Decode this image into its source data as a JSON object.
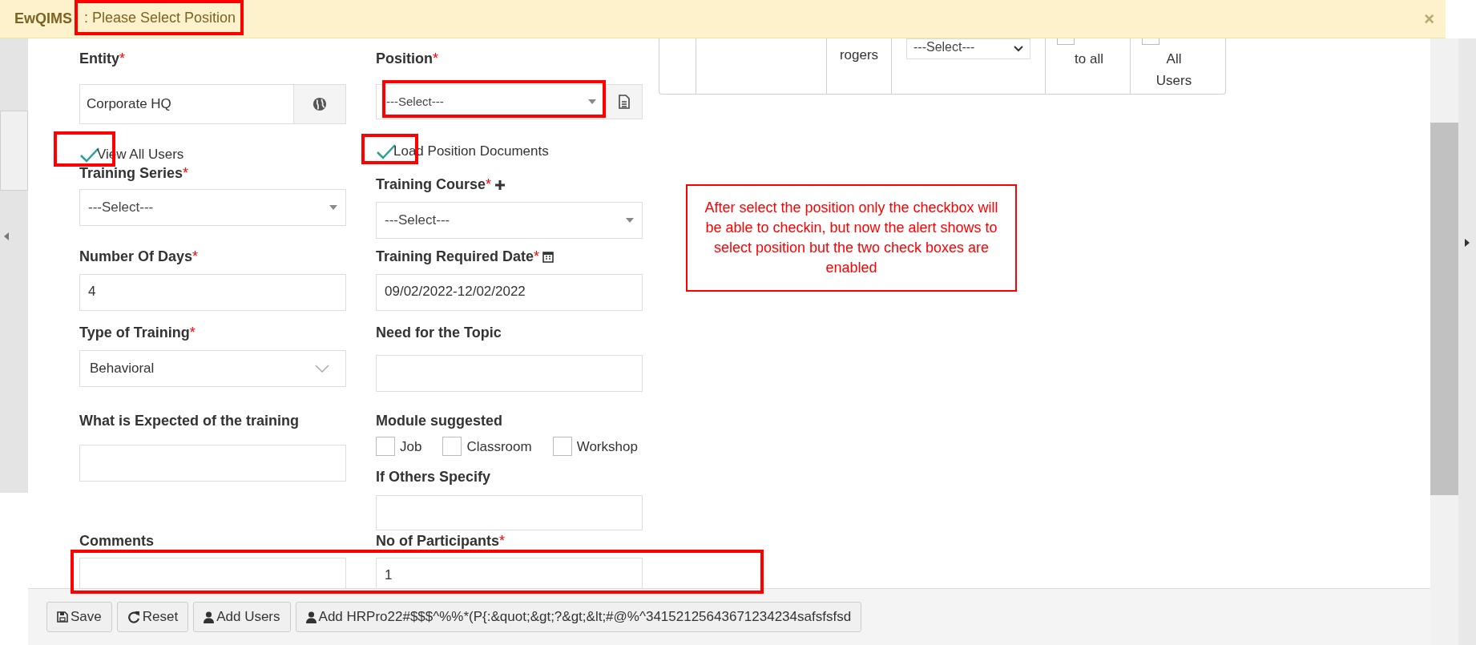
{
  "alert": {
    "app": "EwQIMS",
    "message": ": Please Select Position",
    "close": "×"
  },
  "table_fragment": {
    "cells": [
      {
        "kind": "empty"
      },
      {
        "kind": "empty"
      },
      {
        "kind": "text",
        "text": "rogers"
      },
      {
        "kind": "select",
        "value": "---Select---"
      },
      {
        "kind": "check",
        "text": "to all",
        "checked": false
      },
      {
        "kind": "check",
        "text": "All Users",
        "checked": false
      }
    ]
  },
  "form": {
    "rows": [
      [
        {
          "kind": "lookup",
          "label": "Entity",
          "required_mark": "*",
          "value": "Corporate HQ"
        },
        {
          "kind": "select_doc",
          "label": "Position",
          "required_mark": "*",
          "value": "---Select---"
        }
      ],
      [
        {
          "kind": "checkbox",
          "label": "View All Users",
          "checked": true
        },
        {
          "kind": "checkbox",
          "label": "Load Position Documents",
          "checked": true
        }
      ],
      [
        {
          "kind": "select",
          "label": "Training Series",
          "required_mark": "*",
          "value": "---Select---"
        },
        {
          "kind": "select",
          "label": "Training Course",
          "required_mark": "*",
          "add_button": true,
          "value": "---Select---"
        }
      ],
      [
        {
          "kind": "input",
          "label": "Number Of Days",
          "required_mark": "*",
          "value": "4"
        },
        {
          "kind": "input",
          "label": "Training Required Date",
          "required_mark": "*",
          "date_picker": true,
          "value": "09/02/2022-12/02/2022"
        }
      ],
      [
        {
          "kind": "dropdown",
          "label": "Type of Training",
          "required_mark": "*",
          "value": "Behavioral"
        },
        {
          "kind": "textarea",
          "label": "Need for the Topic"
        }
      ],
      [
        {
          "kind": "textarea",
          "label": "What is Expected of the training"
        },
        {
          "kind": "checks",
          "label": "Module suggested",
          "options": [
            {
              "label": "Job",
              "checked": false
            },
            {
              "label": "Classroom",
              "checked": false
            },
            {
              "label": "Workshop",
              "checked": false
            }
          ],
          "extra": {
            "label": "If Others Specify"
          }
        }
      ],
      [
        {
          "kind": "input",
          "label": "Comments"
        },
        {
          "kind": "input",
          "label": "No of Participants",
          "required_mark": "*",
          "value": "1"
        }
      ]
    ]
  },
  "note": "After select the position only the checkbox will be able to checkin, but now the alert shows to select position but the two check boxes are enabled",
  "buttons": [
    {
      "kind": "save",
      "label": "Save"
    },
    {
      "kind": "reset",
      "label": "Reset"
    },
    {
      "kind": "user",
      "label": "Add Users"
    },
    {
      "kind": "user",
      "label": "Add HRPro22#$$$^%%*(P{:&quot;&gt;?&gt;&lt;#@%^34152125643671234234safsfsfsd"
    }
  ]
}
